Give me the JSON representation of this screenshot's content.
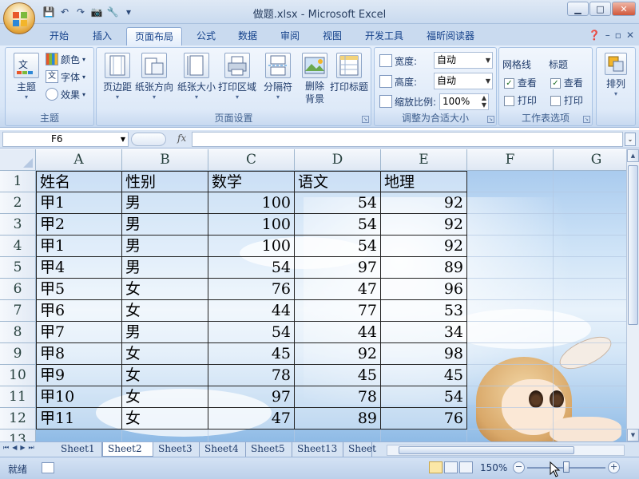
{
  "window": {
    "title": "做题.xlsx - Microsoft Excel"
  },
  "qat": {
    "save": "💾",
    "undo": "↶",
    "redo": "↷",
    "camera": "📷",
    "tools": "🔧",
    "customize": "▾"
  },
  "tabs": [
    "开始",
    "插入",
    "页面布局",
    "公式",
    "数据",
    "审阅",
    "视图",
    "开发工具",
    "福昕阅读器"
  ],
  "active_tab": "页面布局",
  "ribbon": {
    "theme": {
      "label": "主题",
      "themes_button": "主题",
      "colors": "颜色",
      "fonts": "字体",
      "effects": "效果"
    },
    "page_setup": {
      "label": "页面设置",
      "margins": "页边距",
      "orientation": "纸张方向",
      "size": "纸张大小",
      "print_area": "打印区域",
      "breaks": "分隔符",
      "background": "删除\n背景",
      "print_titles": "打印标题"
    },
    "scale_to_fit": {
      "label": "调整为合适大小",
      "width_label": "宽度:",
      "width_value": "自动",
      "height_label": "高度:",
      "height_value": "自动",
      "scale_label": "缩放比例:",
      "scale_value": "100%"
    },
    "sheet_options": {
      "label": "工作表选项",
      "gridlines": "网格线",
      "headings": "标题",
      "view": "查看",
      "print": "打印"
    },
    "arrange": {
      "label": "排列"
    }
  },
  "formula_bar": {
    "name_box": "F6",
    "fx": "fx",
    "formula": ""
  },
  "sheet": {
    "columns": [
      "A",
      "B",
      "C",
      "D",
      "E",
      "F",
      "G"
    ],
    "row_numbers": [
      "1",
      "2",
      "3",
      "4",
      "5",
      "6",
      "7",
      "8",
      "9",
      "10",
      "11",
      "12",
      "13"
    ],
    "header": [
      "姓名",
      "性别",
      "数学",
      "语文",
      "地理"
    ],
    "rows": [
      [
        "甲1",
        "男",
        "100",
        "54",
        "92"
      ],
      [
        "甲2",
        "男",
        "100",
        "54",
        "92"
      ],
      [
        "甲1",
        "男",
        "100",
        "54",
        "92"
      ],
      [
        "甲4",
        "男",
        "54",
        "97",
        "89"
      ],
      [
        "甲5",
        "女",
        "76",
        "47",
        "96"
      ],
      [
        "甲6",
        "女",
        "44",
        "77",
        "53"
      ],
      [
        "甲7",
        "男",
        "54",
        "44",
        "34"
      ],
      [
        "甲8",
        "女",
        "45",
        "92",
        "98"
      ],
      [
        "甲9",
        "女",
        "78",
        "45",
        "45"
      ],
      [
        "甲10",
        "女",
        "97",
        "78",
        "54"
      ],
      [
        "甲11",
        "女",
        "47",
        "89",
        "76"
      ]
    ]
  },
  "sheet_tabs": [
    "Sheet1",
    "Sheet2",
    "Sheet3",
    "Sheet4",
    "Sheet5",
    "Sheet13",
    "Sheet"
  ],
  "active_sheet": "Sheet2",
  "status": {
    "ready": "就绪",
    "zoom": "150%",
    "zoom_fraction": 0.5
  }
}
